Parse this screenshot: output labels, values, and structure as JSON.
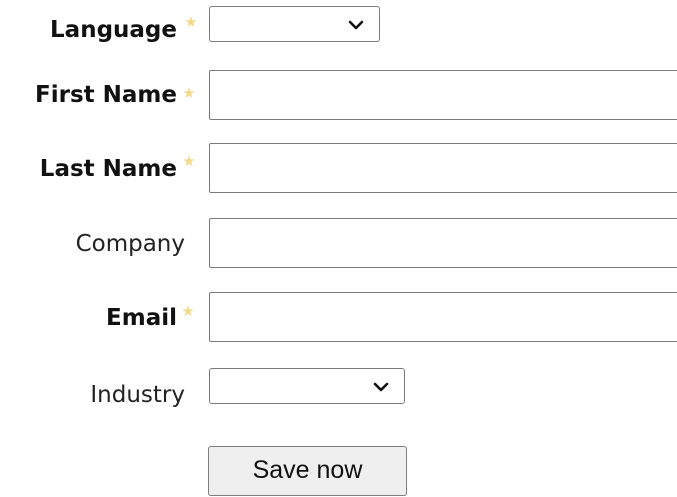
{
  "form": {
    "fields": [
      {
        "label": "Language",
        "required": true,
        "type": "select",
        "value": ""
      },
      {
        "label": "First Name",
        "required": true,
        "type": "text",
        "value": ""
      },
      {
        "label": "Last Name",
        "required": true,
        "type": "text",
        "value": ""
      },
      {
        "label": "Company",
        "required": false,
        "type": "text",
        "value": ""
      },
      {
        "label": "Email",
        "required": true,
        "type": "text",
        "value": ""
      },
      {
        "label": "Industry",
        "required": false,
        "type": "select",
        "value": ""
      }
    ],
    "required_marker": "star",
    "submit_label": "Save now"
  },
  "colors": {
    "required_star": "#f3d98a",
    "border": "#7a7a7a",
    "button_bg": "#efefef"
  }
}
